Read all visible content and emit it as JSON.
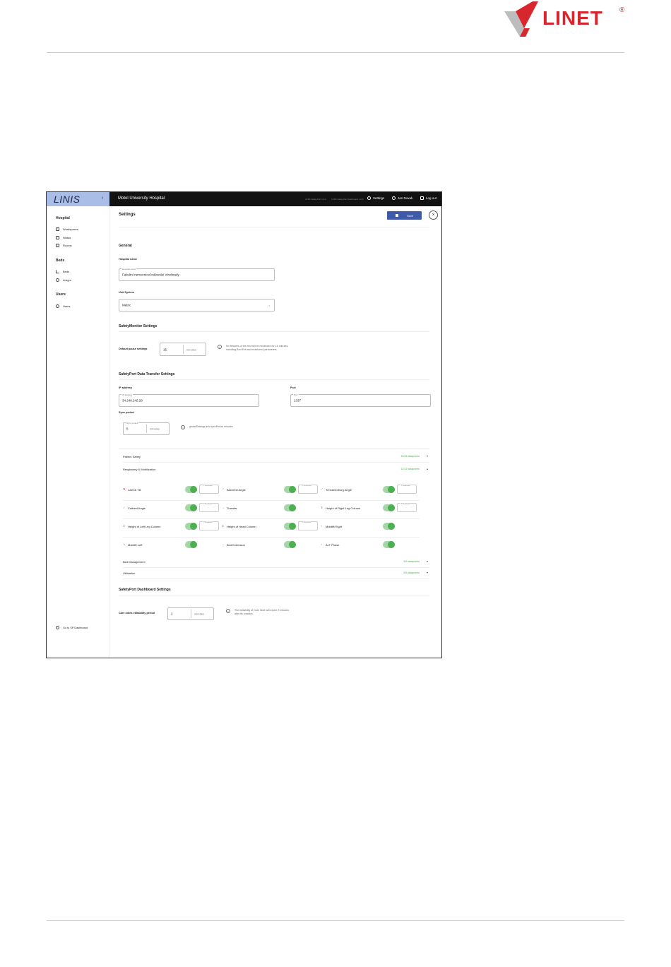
{
  "document": {
    "logo_text": "LINET",
    "logo_mark": "®",
    "brand_color": "#d8262f"
  },
  "app": {
    "brand": "LINIS",
    "hospital": "Motol University Hospital",
    "version_1": "LINIS SafetyPort 1.0.0",
    "version_2": "LINIS SafetyPort Dashboard 1.0.0",
    "nav": {
      "settings": "Settings",
      "user": "Jan Novak",
      "logout": "Log out"
    }
  },
  "sidebar": {
    "sections": [
      {
        "title": "Hospital",
        "items": [
          {
            "label": "Workspaces",
            "icon": "home-icon"
          },
          {
            "label": "Wards",
            "icon": "grid-icon"
          },
          {
            "label": "Rooms",
            "icon": "door-icon"
          }
        ]
      },
      {
        "title": "Beds",
        "items": [
          {
            "label": "Beds",
            "icon": "bed-icon"
          },
          {
            "label": "Insight",
            "icon": "insight-icon"
          }
        ]
      },
      {
        "title": "Users",
        "items": [
          {
            "label": "Users",
            "icon": "user-icon"
          }
        ]
      }
    ],
    "footer_link": "Go to SP Dashboard"
  },
  "settings": {
    "title": "Settings",
    "save_label": "Save",
    "close_glyph": "×",
    "general": {
      "title": "General",
      "hospital_name_label": "Hospital name",
      "hospital_name_float": "Hospital name",
      "hospital_name_value": "Fakultní nemocnice královské Vinohrady",
      "unit_system_label": "Unit System",
      "unit_system_value": "Metric"
    },
    "safety_monitor": {
      "title": "SafetyMonitor Settings",
      "pause_label": "Default pause settings",
      "pause_value": "15",
      "pause_unit": "minutes",
      "info_line1": "No features of the bed will be monitored for 15 minutes,",
      "info_line2": "including Bed Exit and monitored parameters."
    },
    "transfer": {
      "title": "SafetyPort Data Transfer Settings",
      "ip_label": "IP address",
      "ip_float": "IP address",
      "ip_value": "34.240.245.28",
      "port_label": "Port",
      "port_float": "Port",
      "port_value": "1337",
      "sync_label": "Sync period",
      "sync_float": "Sync period",
      "sync_value": "5",
      "sync_unit": "minutes",
      "sync_info": "globalSettings.info.syncPeriod minutes"
    },
    "accordions": [
      {
        "name": "Patient Safety",
        "count": "15/15 datapoints",
        "chevron": "▾"
      },
      {
        "name": "Respiratory & Mobilization",
        "count": "12/12 datapoints",
        "chevron": "▴"
      },
      {
        "name": "Bed Management",
        "count": "9/9 datapoints",
        "chevron": "▾"
      },
      {
        "name": "Utilization",
        "count": "5/5 datapoints",
        "chevron": "▾"
      }
    ],
    "threshold_label": "Threshold",
    "datapoints": [
      {
        "name": "Lateral Tilt",
        "threshold": true
      },
      {
        "name": "Backrest Angle",
        "threshold": true
      },
      {
        "name": "Trendelenburg Angle",
        "threshold": true
      },
      {
        "name": "Calfrest Angle",
        "threshold": true
      },
      {
        "name": "Transfer",
        "threshold": false
      },
      {
        "name": "Height of Right Leg Column",
        "threshold": true
      },
      {
        "name": "Height of Left Leg Column",
        "threshold": true
      },
      {
        "name": "Height of Head Column",
        "threshold": true
      },
      {
        "name": "Mobilift Right",
        "threshold": false
      },
      {
        "name": "Mobilift Left",
        "threshold": false
      },
      {
        "name": "Bed Extension",
        "threshold": false
      },
      {
        "name": "ALT Phase",
        "threshold": false
      }
    ],
    "dashboard": {
      "title": "SafetyPort Dashboard Settings",
      "care_label": "Care notes editability period",
      "care_value": "2",
      "care_unit": "minutes",
      "info_line1": "The editability of Care Note will expire 2 minutes",
      "info_line2": "after its creation."
    }
  },
  "colors": {
    "accent": "#3f5aa8",
    "toggle_on": "#4caf50",
    "brand_panel": "#a9bde6",
    "topbar": "#121212"
  }
}
